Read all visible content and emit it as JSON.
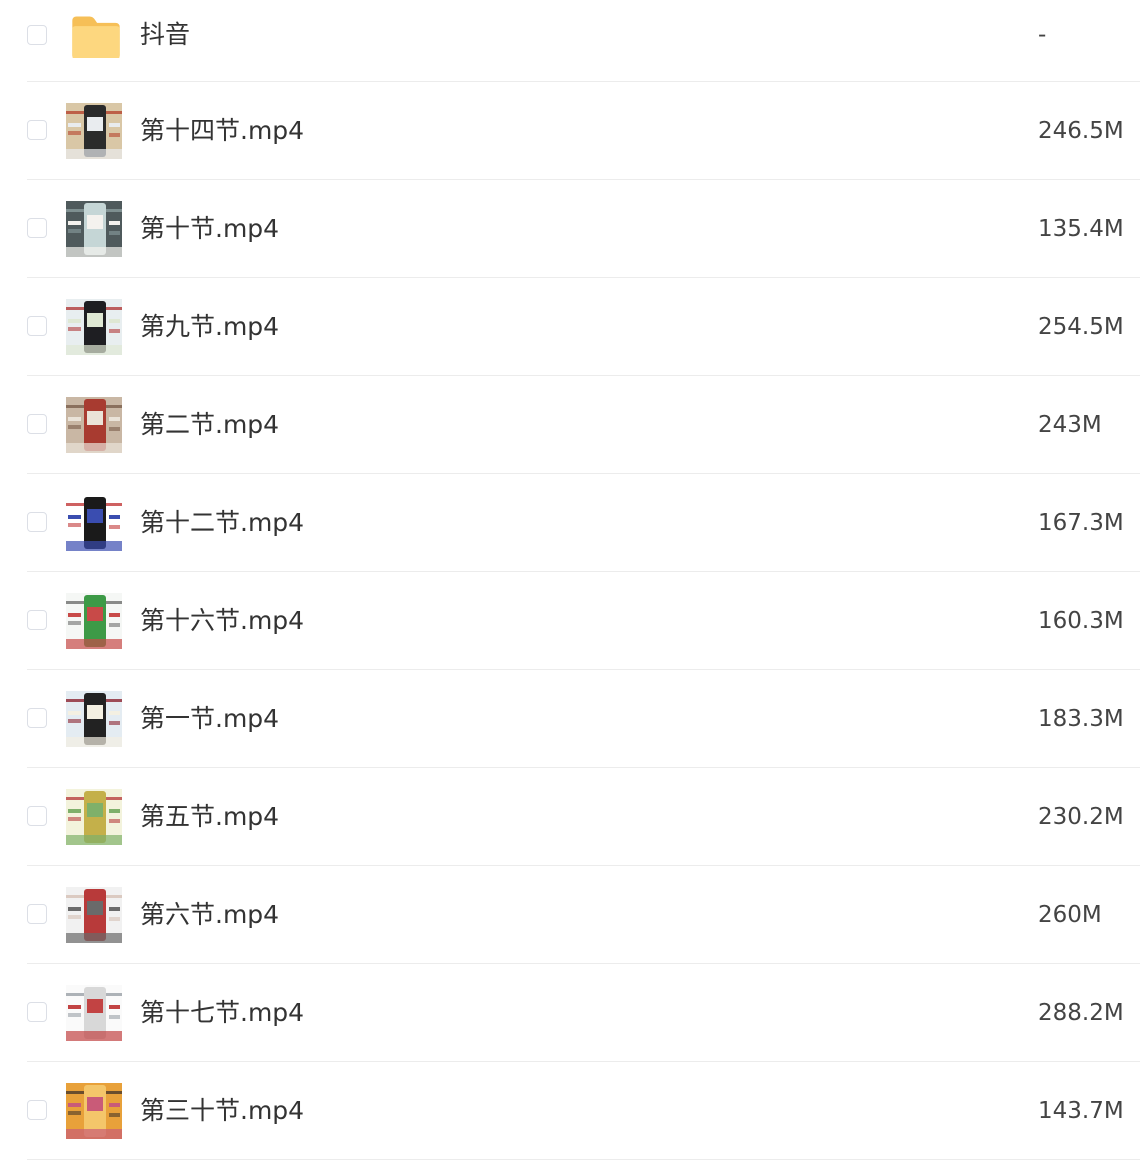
{
  "files": [
    {
      "name": "抖音",
      "size": "-",
      "type": "folder",
      "icon": "folder-icon"
    },
    {
      "name": "第十四节.mp4",
      "size": "246.5M",
      "type": "video",
      "icon": "video-thumbnail",
      "colors": [
        "#d9c7a6",
        "#2b2b2b",
        "#e9ecef",
        "#b5452f"
      ]
    },
    {
      "name": "第十节.mp4",
      "size": "135.4M",
      "type": "video",
      "icon": "video-thumbnail",
      "colors": [
        "#4f5a5c",
        "#c5d6d6",
        "#f4f2ee",
        "#8a9c9e"
      ]
    },
    {
      "name": "第九节.mp4",
      "size": "254.5M",
      "type": "video",
      "icon": "video-thumbnail",
      "colors": [
        "#e8eef0",
        "#1e1e22",
        "#dfe8d4",
        "#b03a3a"
      ]
    },
    {
      "name": "第二节.mp4",
      "size": "243M",
      "type": "video",
      "icon": "video-thumbnail",
      "colors": [
        "#c9b7a4",
        "#a83b30",
        "#eae3d8",
        "#7b5e4b"
      ]
    },
    {
      "name": "第十二节.mp4",
      "size": "167.3M",
      "type": "video",
      "icon": "video-thumbnail",
      "colors": [
        "#ffffff",
        "#1a1a1a",
        "#3a4db0",
        "#c23a3a"
      ]
    },
    {
      "name": "第十六节.mp4",
      "size": "160.3M",
      "type": "video",
      "icon": "video-thumbnail",
      "colors": [
        "#f5f7f5",
        "#3d9a47",
        "#c84a48",
        "#6e6e6e"
      ]
    },
    {
      "name": "第一节.mp4",
      "size": "183.3M",
      "type": "video",
      "icon": "video-thumbnail",
      "colors": [
        "#e4ecf2",
        "#222222",
        "#f4f0e2",
        "#8c2430"
      ]
    },
    {
      "name": "第五节.mp4",
      "size": "230.2M",
      "type": "video",
      "icon": "video-thumbnail",
      "colors": [
        "#f3f3dc",
        "#c4b04a",
        "#7fb06a",
        "#b84040"
      ]
    },
    {
      "name": "第六节.mp4",
      "size": "260M",
      "type": "video",
      "icon": "video-thumbnail",
      "colors": [
        "#f1f1f1",
        "#b83a3a",
        "#6a6a6a",
        "#d6c1b5"
      ]
    },
    {
      "name": "第十七节.mp4",
      "size": "288.2M",
      "type": "video",
      "icon": "video-thumbnail",
      "colors": [
        "#fafafa",
        "#d8d8d8",
        "#c24343",
        "#9aa0a6"
      ]
    },
    {
      "name": "第三十节.mp4",
      "size": "143.7M",
      "type": "video",
      "icon": "video-thumbnail",
      "colors": [
        "#e8a13a",
        "#f4c66a",
        "#c95b78",
        "#4a3a2a"
      ]
    }
  ]
}
